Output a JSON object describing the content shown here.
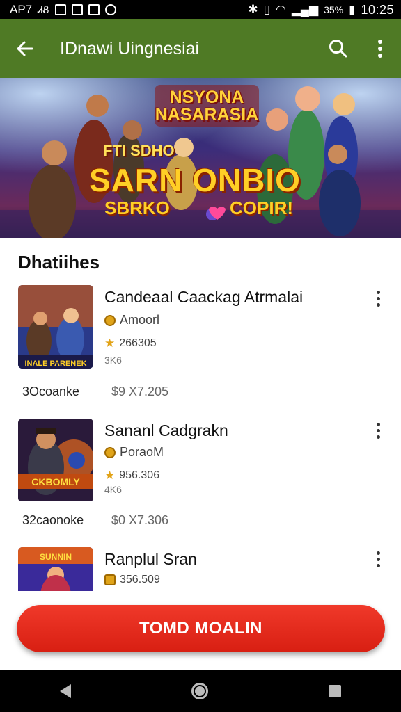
{
  "status_bar": {
    "carrier": "AP7",
    "extra": "ᏗᏰ",
    "battery": "35%",
    "time": "10:25"
  },
  "app_bar": {
    "title": "IDnawi Uingnesiai"
  },
  "banner": {
    "title_line1": "NSYONA",
    "title_line2": "NASARASIA",
    "subtitle": "FTI SDHO",
    "headline": "SARN ONBIO",
    "tag_left": "SBRKO",
    "tag_right": "COPIR!"
  },
  "section": {
    "title": "Dhatiihes"
  },
  "games": [
    {
      "name": "Candeaal Caackag Atrmalai",
      "developer": "Amoorl",
      "rating": "266305",
      "size": "3K6",
      "left_label": "3Ocoanke",
      "price": "$9 X7.205"
    },
    {
      "name": "Sananl Cadgrakn",
      "developer": "PoraoM",
      "rating": "956.306",
      "size": "4K6",
      "left_label": "32caonoke",
      "price": "$0 X7.306"
    },
    {
      "name": "Ranplul Sran",
      "developer": "",
      "rating": "356.509",
      "size": "",
      "left_label": "",
      "price": ""
    }
  ],
  "cta": {
    "label": "TOMD MOALIN"
  },
  "colors": {
    "app_bar": "#4f7a25",
    "cta": "#e12a1c"
  }
}
